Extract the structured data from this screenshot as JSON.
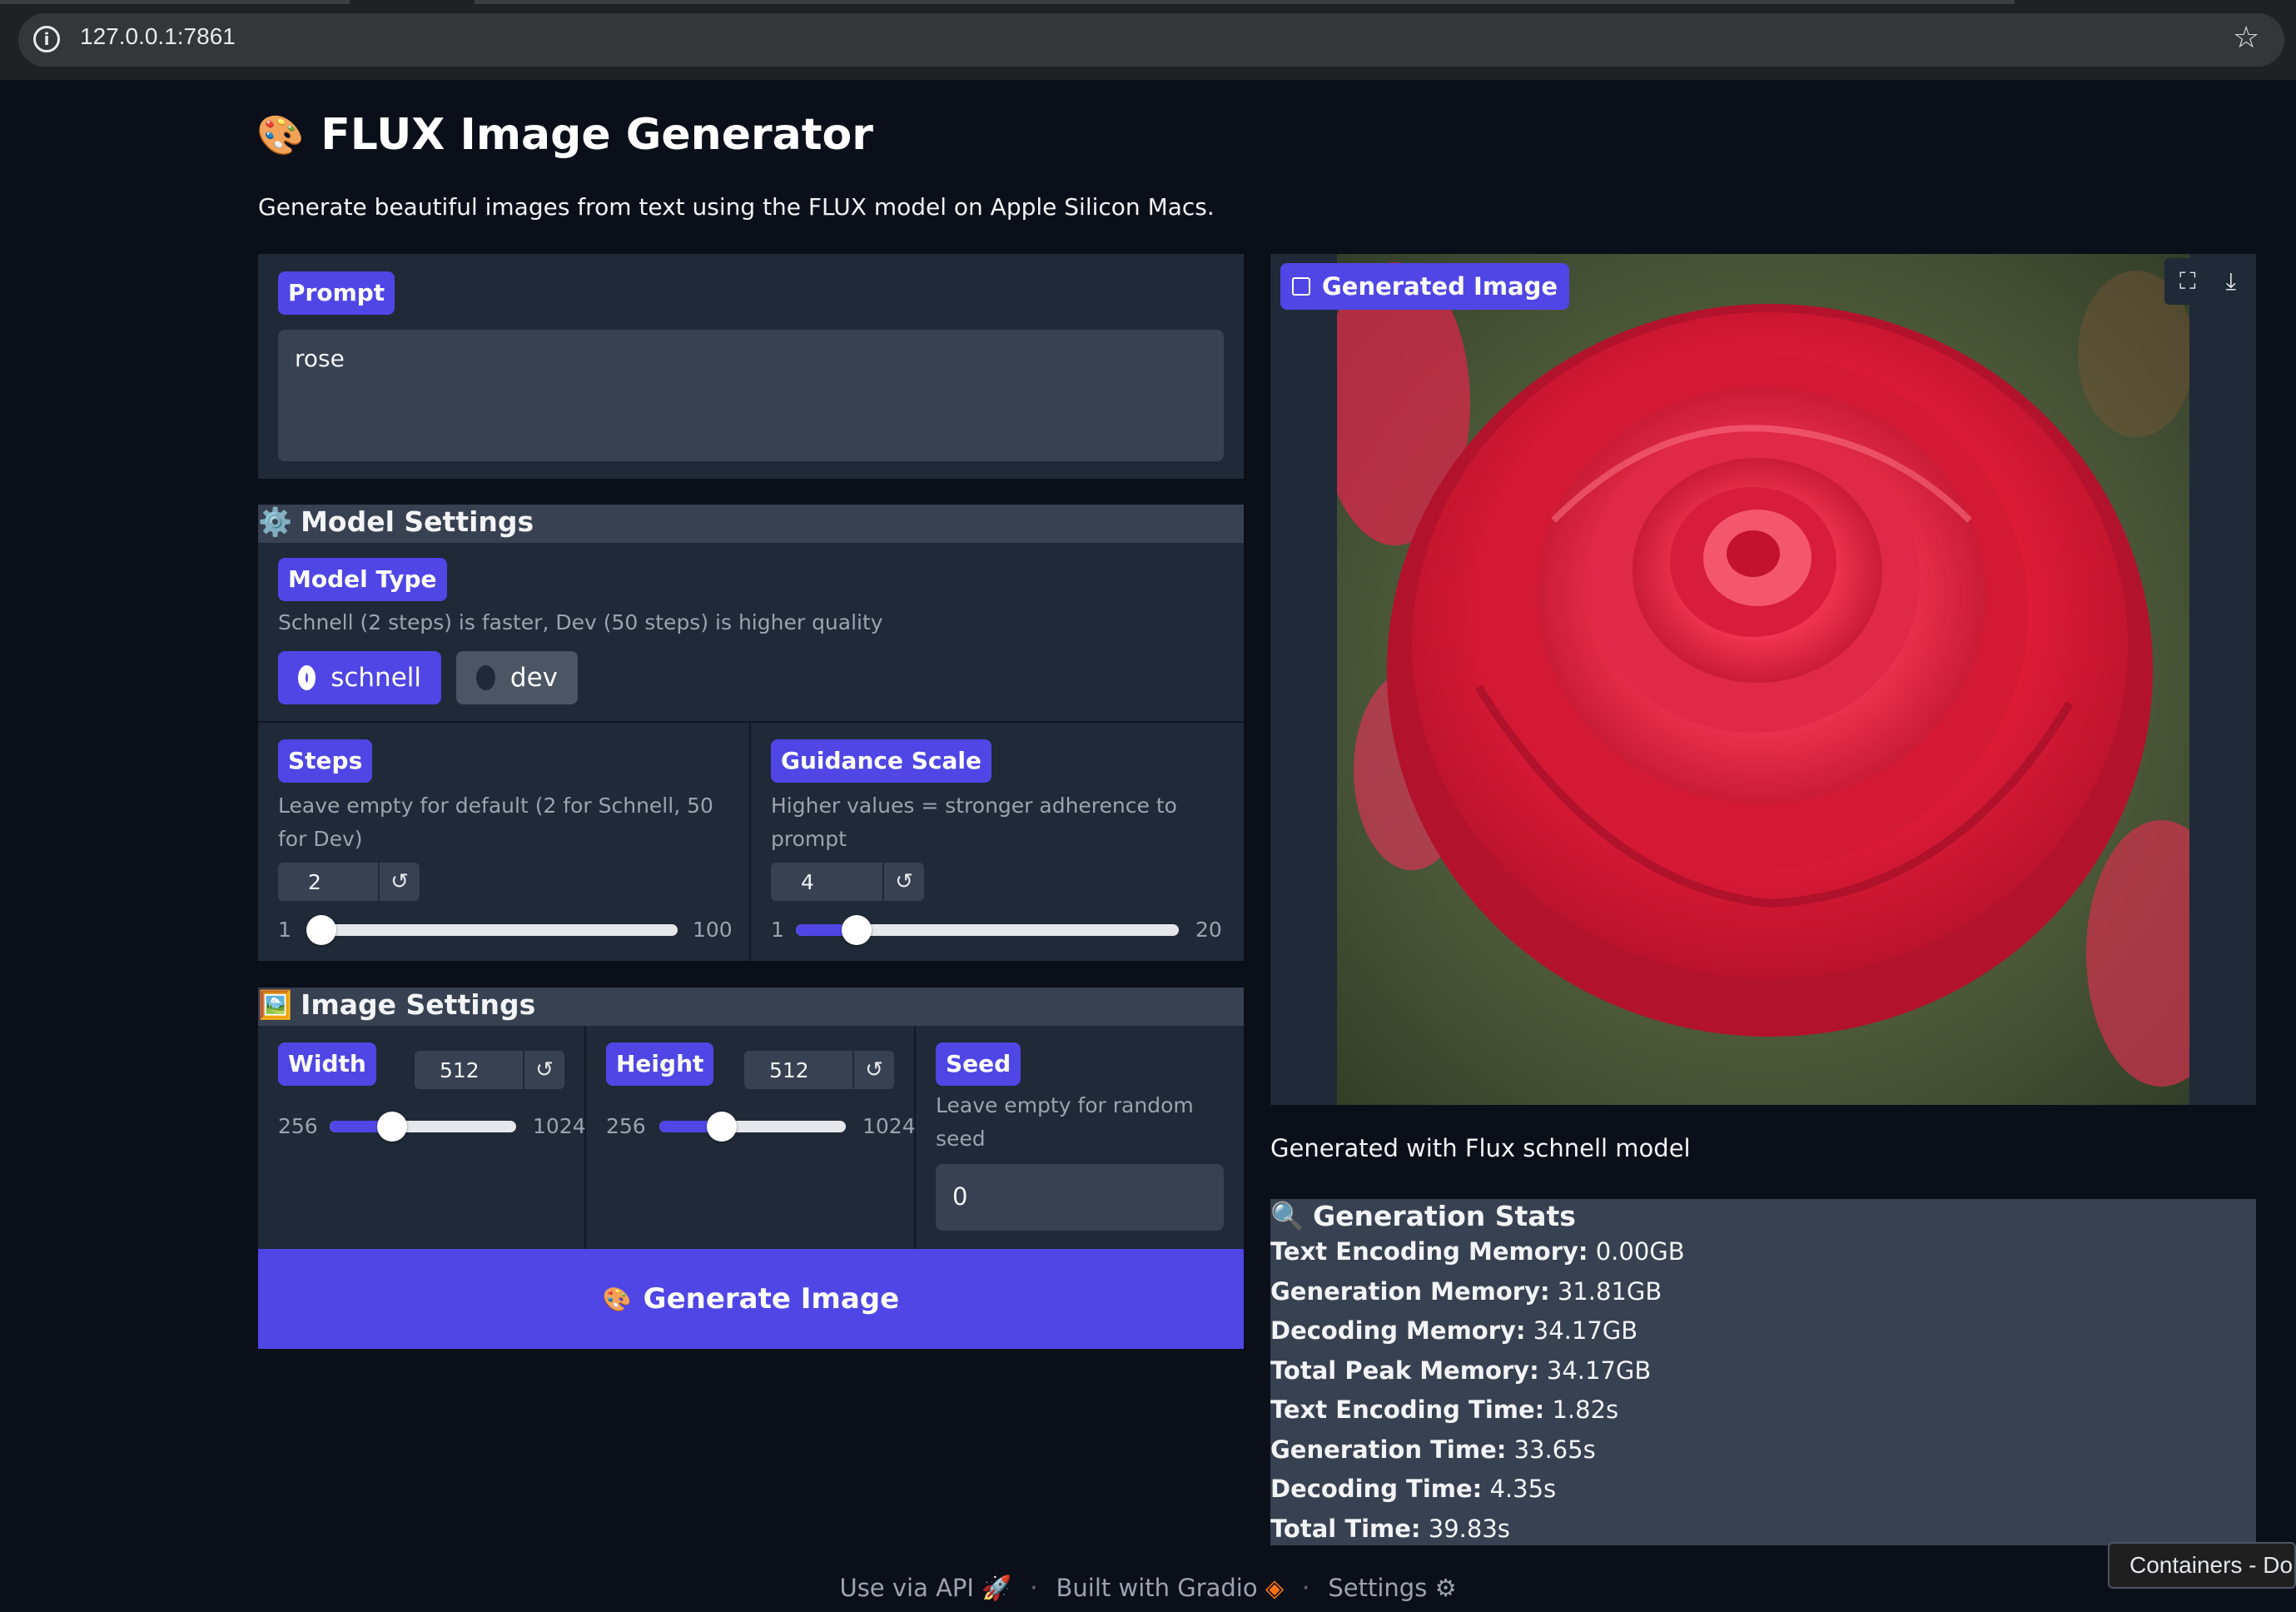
{
  "browser": {
    "url": "127.0.0.1:7861"
  },
  "header": {
    "emoji": "🎨",
    "title": "FLUX Image Generator",
    "description": "Generate beautiful images from text using the FLUX model on Apple Silicon Macs."
  },
  "prompt": {
    "label": "Prompt",
    "value": "rose"
  },
  "model_settings": {
    "icon": "⚙️",
    "title": "Model Settings",
    "model_type": {
      "label": "Model Type",
      "info": "Schnell (2 steps) is faster, Dev (50 steps) is higher quality",
      "options": [
        "schnell",
        "dev"
      ],
      "selected": "schnell"
    },
    "steps": {
      "label": "Steps",
      "info": "Leave empty for default (2 for Schnell, 50 for Dev)",
      "value": "2",
      "min": "1",
      "max": "100",
      "fraction": 0.01
    },
    "guidance": {
      "label": "Guidance Scale",
      "info": "Higher values = stronger adherence to prompt",
      "value": "4",
      "min": "1",
      "max": "20",
      "fraction": 0.158
    }
  },
  "image_settings": {
    "icon": "🖼️",
    "title": "Image Settings",
    "width": {
      "label": "Width",
      "value": "512",
      "min": "256",
      "max": "1024",
      "fraction": 0.333
    },
    "height": {
      "label": "Height",
      "value": "512",
      "min": "256",
      "max": "1024",
      "fraction": 0.333
    },
    "seed": {
      "label": "Seed",
      "info": "Leave empty for random seed",
      "value": "0"
    }
  },
  "generate_button": {
    "emoji": "🎨",
    "label": "Generate Image"
  },
  "output": {
    "label": "Generated Image",
    "caption": "Generated with Flux schnell model"
  },
  "stats": {
    "icon": "🔍",
    "title": "Generation Stats",
    "items": [
      {
        "label": "Text Encoding Memory:",
        "value": "0.00GB"
      },
      {
        "label": "Generation Memory:",
        "value": "31.81GB"
      },
      {
        "label": "Decoding Memory:",
        "value": "34.17GB"
      },
      {
        "label": "Total Peak Memory:",
        "value": "34.17GB"
      },
      {
        "label": "Text Encoding Time:",
        "value": "1.82s"
      },
      {
        "label": "Generation Time:",
        "value": "33.65s"
      },
      {
        "label": "Decoding Time:",
        "value": "4.35s"
      },
      {
        "label": "Total Time:",
        "value": "39.83s"
      }
    ]
  },
  "footer": {
    "api": "Use via API",
    "gradio": "Built with Gradio",
    "settings": "Settings",
    "sep": "·"
  },
  "tooltip": "Containers - Do"
}
